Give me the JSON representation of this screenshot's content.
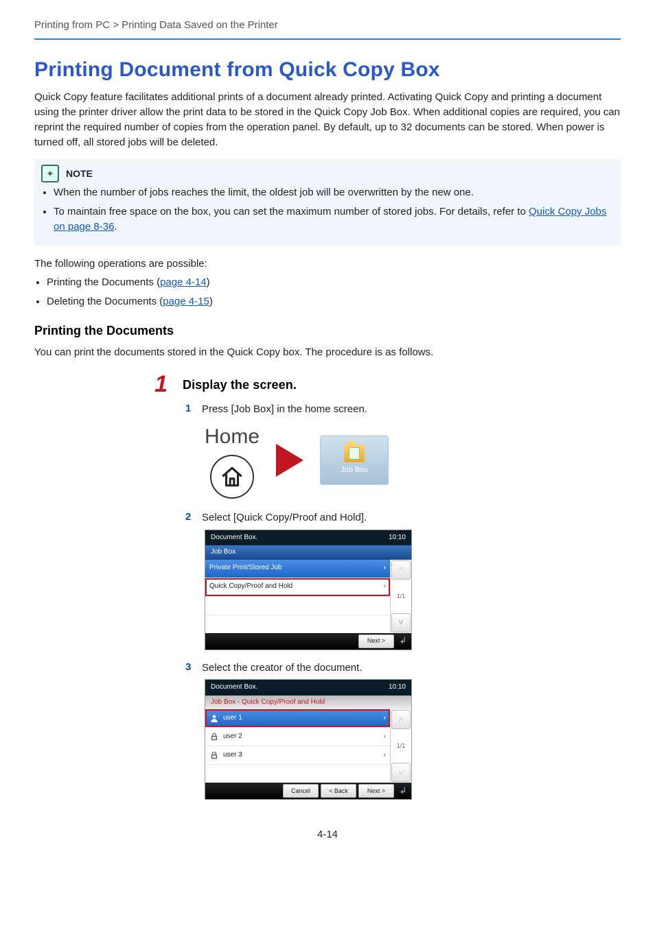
{
  "breadcrumb": "Printing from PC > Printing Data Saved on the Printer",
  "title": "Printing Document from Quick Copy Box",
  "intro": "Quick Copy feature facilitates additional prints of a document already printed. Activating Quick Copy and printing a document using the printer driver allow the print data to be stored in the Quick Copy Job Box. When additional copies are required, you can reprint the required number of copies from the operation panel. By default, up to 32 documents can be stored. When power is turned off, all stored jobs will be deleted.",
  "note_label": "NOTE",
  "note_items": [
    "When the number of jobs reaches the limit, the oldest job will be overwritten by the new one.",
    "To maintain free space on the box, you can set the maximum number of stored jobs. For details, refer to "
  ],
  "note_link_text": "Quick Copy Jobs on page 8-36",
  "after_note": "The following operations are possible:",
  "ops": [
    {
      "t": "Printing the Documents (",
      "l": "page 4-14",
      "e": ")"
    },
    {
      "t": "Deleting the Documents (",
      "l": "page 4-15",
      "e": ")"
    }
  ],
  "subhead": "Printing the Documents",
  "sub_intro": "You can print the documents stored in the Quick Copy box. The procedure is as follows.",
  "steps": {
    "num": "1",
    "title": "Display the screen.",
    "subs": [
      {
        "n": "1",
        "t": "Press [Job Box] in the home screen."
      },
      {
        "n": "2",
        "t": "Select [Quick Copy/Proof and Hold]."
      },
      {
        "n": "3",
        "t": "Select the creator of the document."
      }
    ]
  },
  "illust": {
    "home_label": "Home",
    "tile_label": "Job Box"
  },
  "screen1": {
    "title": "Document Box.",
    "time": "10:10",
    "sub": "Job Box",
    "rows": [
      {
        "label": "Private Print/Stored Job",
        "blue": true,
        "chev": true
      },
      {
        "label": "Quick Copy/Proof and Hold",
        "blue": false,
        "chev": true,
        "hl": true
      }
    ],
    "page": "1/1",
    "buttons": [
      "Next >"
    ]
  },
  "screen2": {
    "title": "Document Box.",
    "time": "10:10",
    "sub": "Job Box - Quick Copy/Proof and Hold",
    "rows": [
      {
        "label": "user 1",
        "blue": true,
        "chev": true,
        "icon": "person-icon"
      },
      {
        "label": "user 2",
        "blue": false,
        "chev": true,
        "icon": "lock-icon"
      },
      {
        "label": "user 3",
        "blue": false,
        "chev": true,
        "icon": "lock-icon"
      }
    ],
    "page": "1/1",
    "buttons": [
      "Cancel",
      "< Back",
      "Next >"
    ]
  },
  "page_no": "4-14"
}
